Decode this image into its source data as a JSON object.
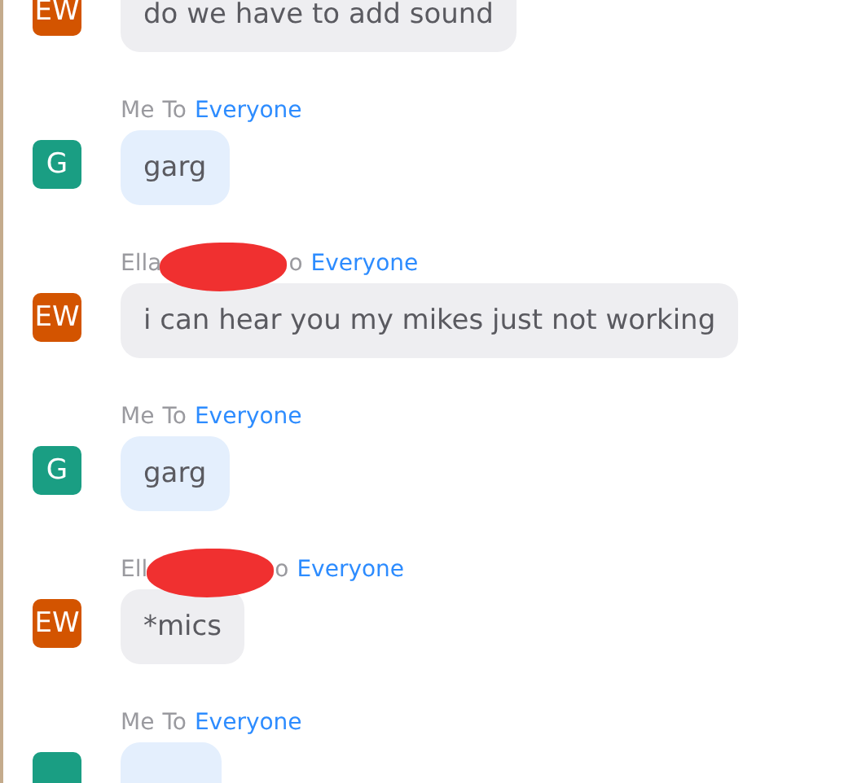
{
  "messages": [
    {
      "kind": "other",
      "avatar": "EW",
      "color": "#d35400",
      "text": "do we have to add sound"
    },
    {
      "kind": "self",
      "sender": "Me",
      "to": "To",
      "recipient": "Everyone",
      "avatar": "G",
      "color": "#1a9e83",
      "text": "garg"
    },
    {
      "kind": "other",
      "sender": "Ella",
      "to": "o",
      "redacted": true,
      "recipient": "Everyone",
      "avatar": "EW",
      "color": "#d35400",
      "text": "i can hear you my mikes just not working"
    },
    {
      "kind": "self",
      "sender": "Me",
      "to": "To",
      "recipient": "Everyone",
      "avatar": "G",
      "color": "#1a9e83",
      "text": "garg"
    },
    {
      "kind": "other",
      "sender": "Ell",
      "to": "o",
      "redacted": true,
      "recipient": "Everyone",
      "avatar": "EW",
      "color": "#d35400",
      "text": "*mics"
    },
    {
      "kind": "self",
      "sender": "Me",
      "to": "To",
      "recipient": "Everyone",
      "color": "#1a9e83"
    }
  ]
}
